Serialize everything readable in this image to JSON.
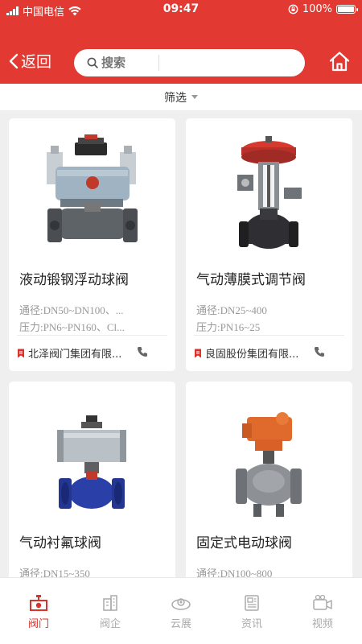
{
  "status": {
    "carrier": "中国电信",
    "time": "09:47",
    "battery": "100%"
  },
  "nav": {
    "back_label": "返回",
    "search_placeholder": "搜索"
  },
  "filter": {
    "label": "筛选"
  },
  "products": [
    {
      "title": "液动锻钢浮动球阀",
      "spec1": "通径:DN50~DN100、...",
      "spec2": "压力:PN6~PN160、Cl...",
      "company": "北泽阀门集团有限..."
    },
    {
      "title": "气动薄膜式调节阀",
      "spec1": "通径:DN25~400",
      "spec2": "压力:PN16~25",
      "company": "良固股份集团有限..."
    },
    {
      "title": "气动衬氟球阀",
      "spec1": "通径:DN15~350",
      "spec2": "",
      "company": ""
    },
    {
      "title": "固定式电动球阀",
      "spec1": "通径:DN100~800",
      "spec2": "",
      "company": ""
    }
  ],
  "tabs": [
    {
      "label": "阀门",
      "icon": "valve-icon",
      "active": true
    },
    {
      "label": "阀企",
      "icon": "building-icon",
      "active": false
    },
    {
      "label": "云展",
      "icon": "cloud-expo-icon",
      "active": false
    },
    {
      "label": "资讯",
      "icon": "newspaper-icon",
      "active": false
    },
    {
      "label": "视频",
      "icon": "video-icon",
      "active": false
    }
  ],
  "colors": {
    "brand_red": "#e23a33",
    "background": "#efefef",
    "muted_text": "#999999"
  }
}
